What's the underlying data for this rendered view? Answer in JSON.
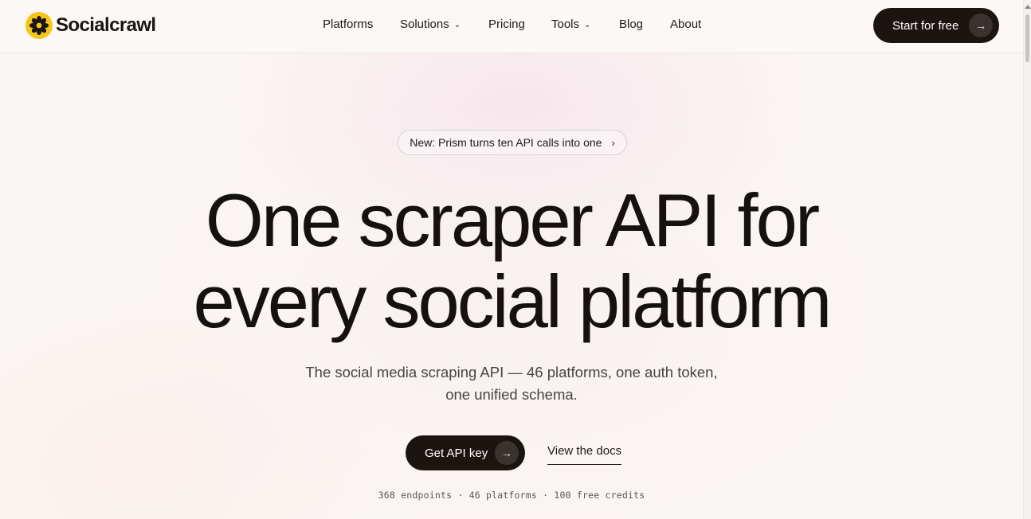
{
  "brand": {
    "name": "Socialcrawl",
    "logo_color": "#f5c518"
  },
  "nav": {
    "items": [
      {
        "label": "Platforms",
        "has_dropdown": false
      },
      {
        "label": "Solutions",
        "has_dropdown": true
      },
      {
        "label": "Pricing",
        "has_dropdown": false
      },
      {
        "label": "Tools",
        "has_dropdown": true
      },
      {
        "label": "Blog",
        "has_dropdown": false
      },
      {
        "label": "About",
        "has_dropdown": false
      }
    ],
    "cta_label": "Start for free"
  },
  "hero": {
    "announcement": "New: Prism turns ten API calls into one",
    "headline_line1": "One scraper API for",
    "headline_line2": "every social platform",
    "subhead_line1": "The social media scraping API — 46 platforms, one auth token,",
    "subhead_line2": "one unified schema.",
    "primary_button": "Get API key",
    "secondary_link": "View the docs",
    "stats": "368 endpoints · 46 platforms · 100 free credits"
  },
  "icons": {
    "logo": "flower-icon",
    "arrow": "arrow-right-icon",
    "dropdown": "chevron-down-icon",
    "announcement": "chevron-right-icon"
  },
  "colors": {
    "dark": "#1c1410",
    "background": "#faf6f3"
  }
}
